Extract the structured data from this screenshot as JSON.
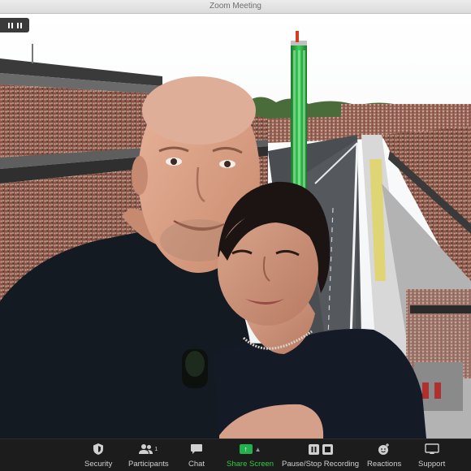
{
  "window": {
    "title": "Zoom Meeting"
  },
  "video": {
    "pause_control": "pause-icon",
    "background": "Indianapolis speedway grandstand virtual background"
  },
  "toolbar": {
    "items": [
      {
        "label": "Security",
        "icon": "shield-icon"
      },
      {
        "label": "Participants",
        "icon": "participants-icon",
        "count": "1"
      },
      {
        "label": "Chat",
        "icon": "chat-icon"
      },
      {
        "label": "Share Screen",
        "icon": "share-screen-icon"
      },
      {
        "label": "Pause/Stop Recording",
        "icon": "recording-icon"
      },
      {
        "label": "Reactions",
        "icon": "reactions-icon"
      },
      {
        "label": "Support",
        "icon": "support-icon"
      }
    ],
    "accent_color": "#2ecc40"
  }
}
